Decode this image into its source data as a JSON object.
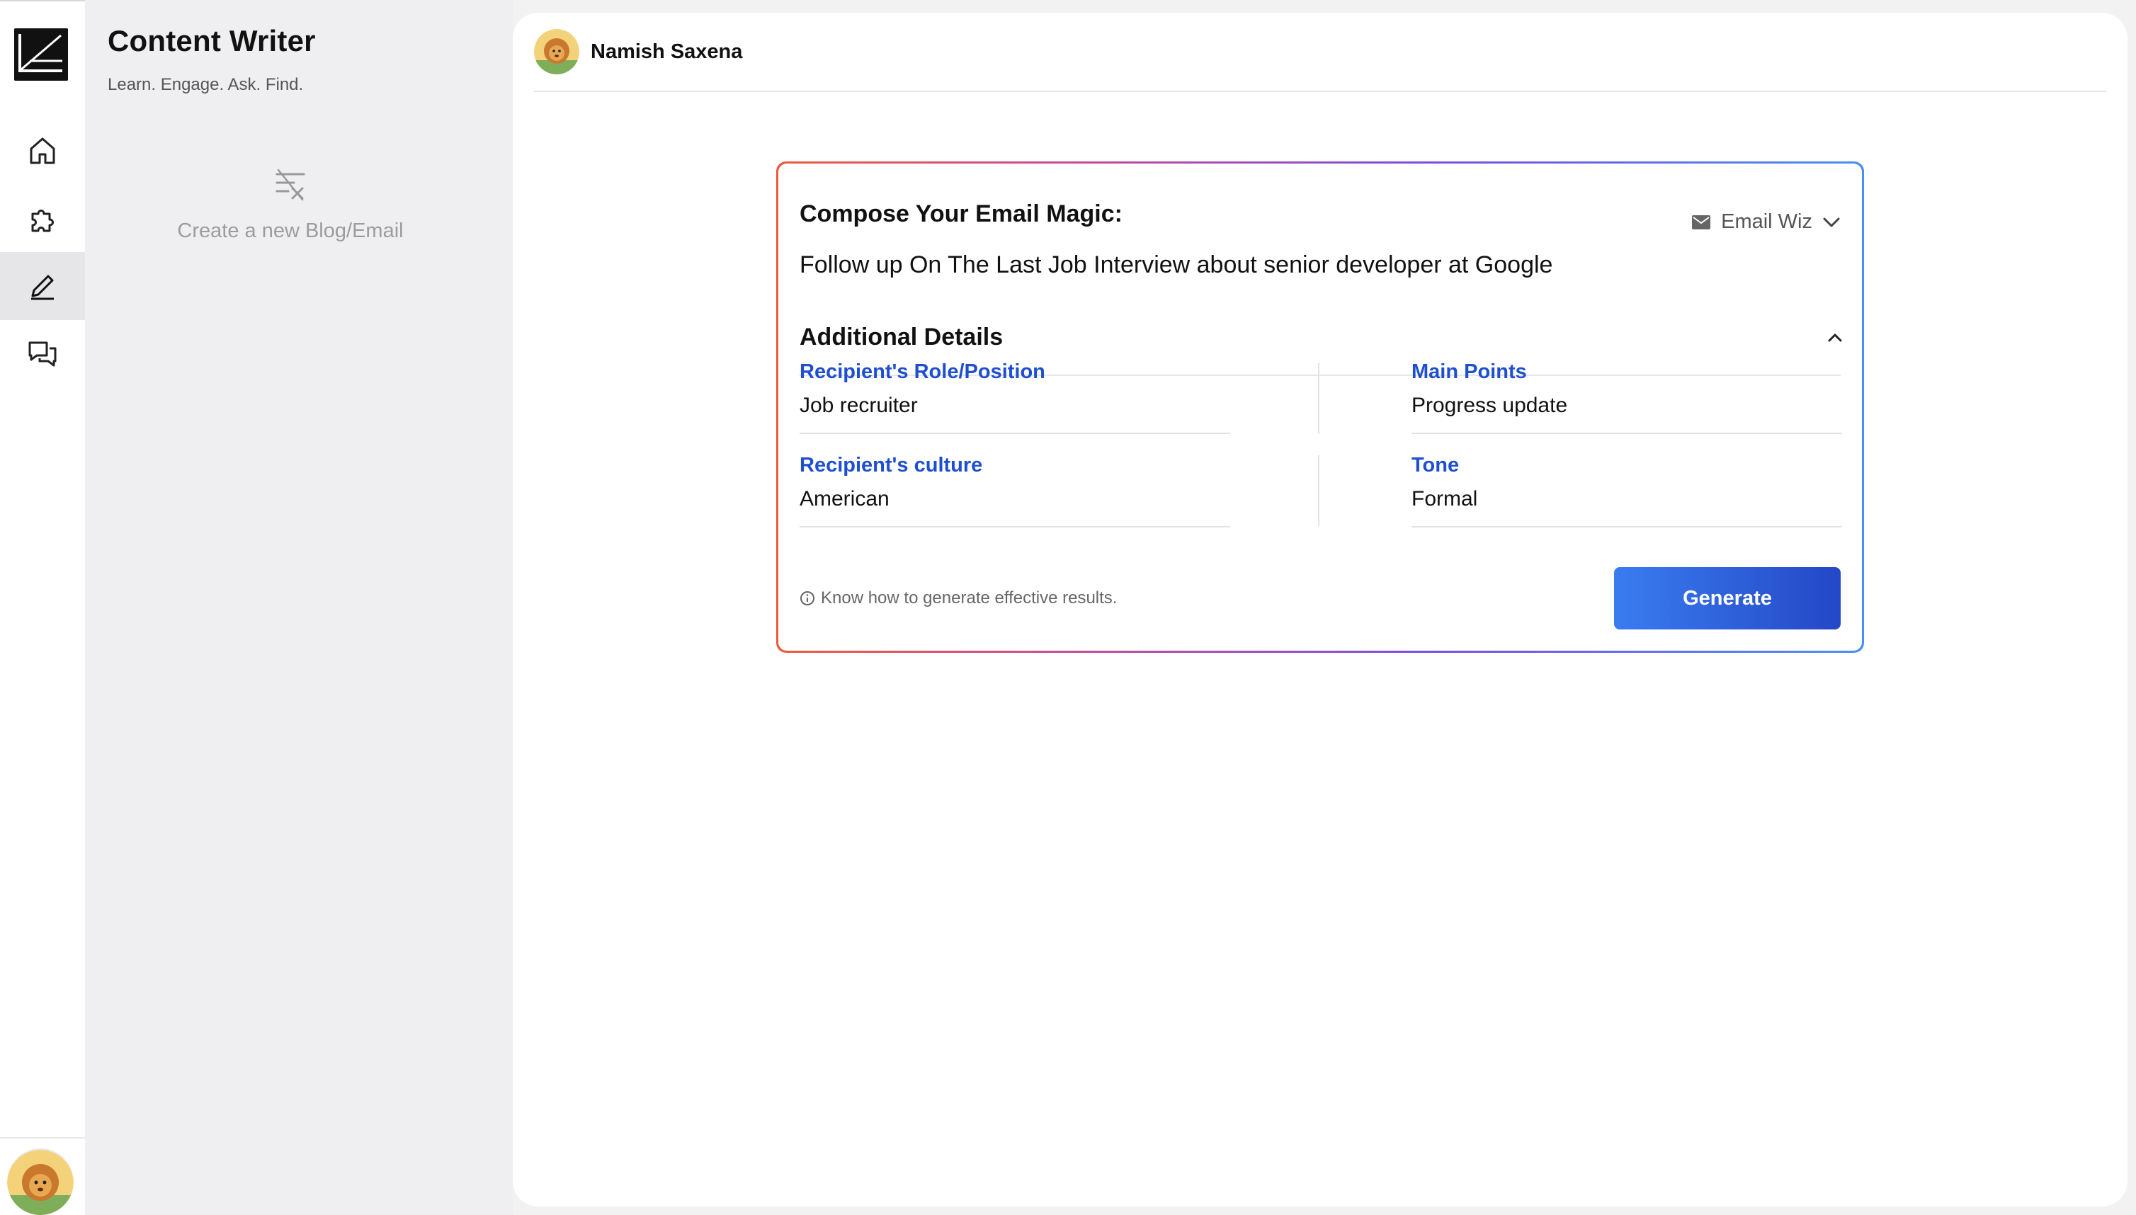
{
  "app": {
    "title": "Content Writer",
    "subtitle": "Learn. Engage. Ask. Find."
  },
  "rail": {
    "items": [
      {
        "name": "home",
        "icon": "home-icon",
        "active": false
      },
      {
        "name": "plugins",
        "icon": "puzzle-icon",
        "active": false
      },
      {
        "name": "content-writer",
        "icon": "pen-icon",
        "active": true
      },
      {
        "name": "chat",
        "icon": "chat-icon",
        "active": false
      }
    ]
  },
  "side_panel": {
    "new_item_label": "Create a new Blog/Email",
    "new_item_icon": "clear-format-icon"
  },
  "user": {
    "name": "Namish Saxena",
    "avatar": "lion-avatar"
  },
  "compose": {
    "title": "Compose Your Email Magic:",
    "mode_label": "Email Wiz",
    "mode_icon": "mail-icon",
    "prompt": "Follow up On The Last Job Interview about senior developer at Google"
  },
  "details": {
    "heading": "Additional Details",
    "fields": [
      {
        "key": "Recipient's Role/Position",
        "value": "Job recruiter"
      },
      {
        "key": "Main Points",
        "value": "Progress update"
      },
      {
        "key": "Recipient's culture",
        "value": "American"
      },
      {
        "key": "Tone",
        "value": "Formal"
      }
    ]
  },
  "footer": {
    "hint": "Know how to generate effective results.",
    "generate_label": "Generate"
  },
  "colors": {
    "accent_blue": "#1f4fd1",
    "button_start": "#3a7cf0",
    "button_end": "#2447c6",
    "border_gradient_start": "#ef5a3c",
    "border_gradient_end": "#4a8ef0"
  }
}
